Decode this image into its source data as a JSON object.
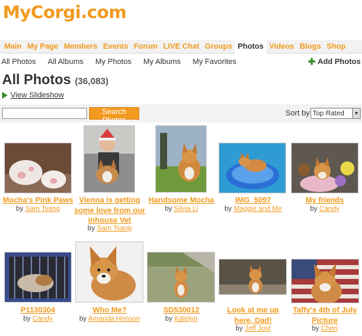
{
  "site": {
    "logo": "MyCorgi.com"
  },
  "main_nav": [
    {
      "label": "Main"
    },
    {
      "label": "My Page"
    },
    {
      "label": "Members"
    },
    {
      "label": "Events"
    },
    {
      "label": "Forum"
    },
    {
      "label": "LIVE Chat"
    },
    {
      "label": "Groups"
    },
    {
      "label": "Photos",
      "active": true
    },
    {
      "label": "Videos"
    },
    {
      "label": "Blogs"
    },
    {
      "label": "Shop"
    }
  ],
  "sub_nav": [
    {
      "label": "All Photos"
    },
    {
      "label": "All Albums"
    },
    {
      "label": "My Photos"
    },
    {
      "label": "My Albums"
    },
    {
      "label": "My Favorites"
    }
  ],
  "add_photos": {
    "label": "Add Photos",
    "icon": "plus-icon"
  },
  "page": {
    "title": "All Photos",
    "count": "(36,083)"
  },
  "slideshow": {
    "label": "View Slideshow",
    "icon": "play-icon"
  },
  "search": {
    "placeholder": "",
    "button_label": "Search Photos"
  },
  "sort": {
    "label": "Sort by:",
    "value": "Top Rated"
  },
  "colors": {
    "accent": "#f29a1f",
    "icon_green": "#3a8e2c",
    "bar_bg": "#f2f2f2"
  },
  "photos": [
    {
      "title": "Mocha's Pink Paws",
      "by": "by",
      "author": "Sam Tsang"
    },
    {
      "title": "Vienna is getting some love from our inhouse Vet",
      "by": "by",
      "author": "Sam Tsang"
    },
    {
      "title": "Handsome Mocha",
      "by": "by",
      "author": "Silvia Li"
    },
    {
      "title": "IMG_5097",
      "by": "by",
      "author": "Maggie and Me"
    },
    {
      "title": "My friends",
      "by": "by",
      "author": "Candy"
    },
    {
      "title": "P1130304",
      "by": "by",
      "author": "Candy"
    },
    {
      "title": "Who Me?",
      "by": "by",
      "author": "Amanda Henson"
    },
    {
      "title": "SD530012",
      "by": "by",
      "author": "Katelyn"
    },
    {
      "title": "Look at me up here, Dad!",
      "by": "by",
      "author": "Jeff Jost"
    },
    {
      "title": "Taffy's 4th of July Picture",
      "by": "by",
      "author": "Cheri"
    }
  ]
}
